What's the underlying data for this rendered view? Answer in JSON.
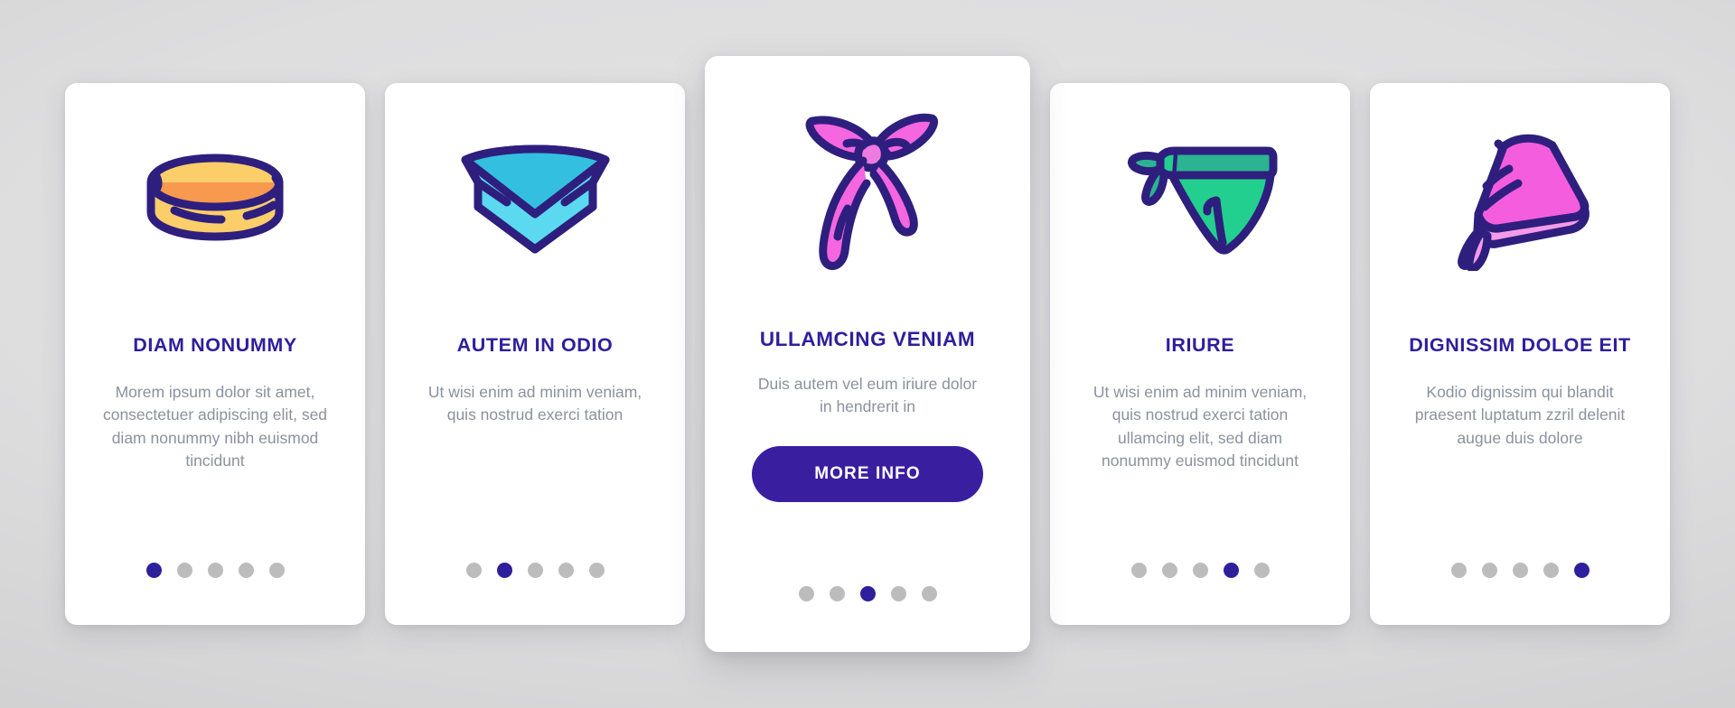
{
  "background": {
    "color_outer": "#c3c3c4",
    "color_inner": "#e3e3e3"
  },
  "theme": {
    "title_color": "#2e1f9c",
    "body_color": "#8a929d",
    "button_color": "#3a1ea0",
    "dot_active_color": "#2e1f9c",
    "dot_inactive_color": "#bcbcbc",
    "card_background": "#ffffff",
    "icon_stroke": "#2e1f7e"
  },
  "cards": [
    {
      "id": "card-diam-nonummy",
      "icon_name": "neck-gaiter-snood-icon",
      "icon_colors": {
        "fill": "#fbce69",
        "accent": "#f79a4f",
        "stroke": "#2e1f7e"
      },
      "title": "DIAM NONUMMY",
      "body": "Morem ipsum dolor sit amet, consectetuer adipiscing elit, sed diam nonummy nibh euismod tincidunt",
      "featured": false,
      "dots": {
        "count": 5,
        "active_index": 0
      }
    },
    {
      "id": "card-autem-in-odio",
      "icon_name": "folded-triangle-scarf-icon",
      "icon_colors": {
        "fill": "#5ad9f0",
        "accent": "#33bfe0",
        "stroke": "#2e1f7e"
      },
      "title": "AUTEM IN ODIO",
      "body": "Ut wisi enim ad minim veniam, quis nostrud exerci tation",
      "featured": false,
      "dots": {
        "count": 5,
        "active_index": 1
      }
    },
    {
      "id": "card-ullamcing-veniam",
      "icon_name": "tied-headband-bandana-icon",
      "icon_colors": {
        "fill": "#f566e0",
        "accent": "#ee7be0",
        "stroke": "#2e1f7e"
      },
      "title": "ULLAMCING VENIAM",
      "body": "Duis autem vel eum iriure dolor in hendrerit in",
      "featured": true,
      "button_label": "MORE INFO",
      "dots": {
        "count": 5,
        "active_index": 2
      }
    },
    {
      "id": "card-iriure",
      "icon_name": "face-bandana-icon",
      "icon_colors": {
        "fill": "#22cf8e",
        "accent": "#2bb392",
        "stroke": "#2e1f7e"
      },
      "title": "IRIURE",
      "body": "Ut wisi enim ad minim veniam, quis nostrud exerci tation ullamcing elit, sed diam nonummy euismod tincidunt",
      "featured": false,
      "dots": {
        "count": 5,
        "active_index": 3
      }
    },
    {
      "id": "card-dignissim-doloe-eit",
      "icon_name": "head-kerchief-babushka-icon",
      "icon_colors": {
        "fill": "#f55ddf",
        "accent": "#f59ae8",
        "stroke": "#2e1f7e"
      },
      "title": "DIGNISSIM DOLOE EIT",
      "body": "Kodio dignissim qui blandit praesent luptatum zzril delenit augue duis dolore",
      "featured": false,
      "dots": {
        "count": 5,
        "active_index": 4
      }
    }
  ]
}
